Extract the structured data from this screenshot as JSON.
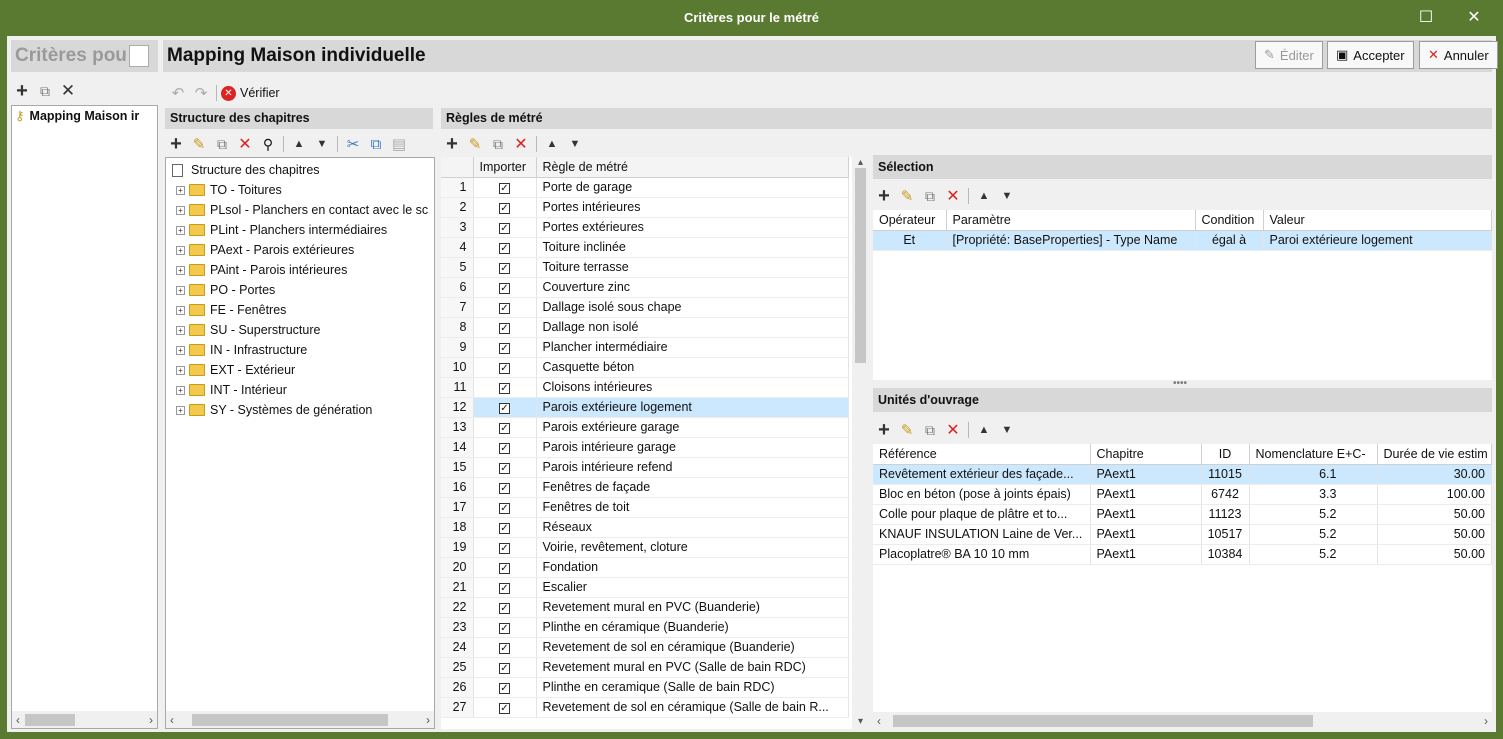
{
  "window": {
    "title": "Critères pour le métré",
    "maximize": "☐",
    "close": "✕"
  },
  "left": {
    "title": "Critères pou",
    "tree_item": "Mapping Maison ir"
  },
  "header": {
    "title": "Mapping Maison individuelle",
    "edit": "Éditer",
    "accept": "Accepter",
    "cancel": "Annuler",
    "verify": "Vérifier"
  },
  "chapters": {
    "header": "Structure des chapitres",
    "root": "Structure des chapitres",
    "items": [
      "TO - Toitures",
      "PLsol - Planchers en contact avec le sc",
      "PLint - Planchers intermédiaires",
      "PAext - Parois extérieures",
      "PAint - Parois intérieures",
      "PO - Portes",
      "FE - Fenêtres",
      "SU - Superstructure",
      "IN - Infrastructure",
      "EXT - Extérieur",
      "INT - Intérieur",
      "SY - Systèmes de génération"
    ]
  },
  "rules": {
    "header": "Règles de métré",
    "col_import": "Importer",
    "col_rule": "Règle de métré",
    "rows": [
      {
        "n": "1",
        "name": "Porte de garage"
      },
      {
        "n": "2",
        "name": "Portes intérieures"
      },
      {
        "n": "3",
        "name": "Portes extérieures"
      },
      {
        "n": "4",
        "name": "Toiture inclinée"
      },
      {
        "n": "5",
        "name": "Toiture terrasse"
      },
      {
        "n": "6",
        "name": "Couverture zinc"
      },
      {
        "n": "7",
        "name": "Dallage isolé sous chape"
      },
      {
        "n": "8",
        "name": "Dallage non isolé"
      },
      {
        "n": "9",
        "name": "Plancher intermédiaire"
      },
      {
        "n": "10",
        "name": "Casquette béton"
      },
      {
        "n": "11",
        "name": "Cloisons intérieures"
      },
      {
        "n": "12",
        "name": "Parois extérieure logement"
      },
      {
        "n": "13",
        "name": "Parois extérieure garage"
      },
      {
        "n": "14",
        "name": "Parois intérieure garage"
      },
      {
        "n": "15",
        "name": "Parois intérieure refend"
      },
      {
        "n": "16",
        "name": "Fenêtres de façade"
      },
      {
        "n": "17",
        "name": "Fenêtres de toit"
      },
      {
        "n": "18",
        "name": "Réseaux"
      },
      {
        "n": "19",
        "name": "Voirie, revêtement, cloture"
      },
      {
        "n": "20",
        "name": "Fondation"
      },
      {
        "n": "21",
        "name": "Escalier"
      },
      {
        "n": "22",
        "name": "Revetement mural en PVC (Buanderie)"
      },
      {
        "n": "23",
        "name": "Plinthe en céramique (Buanderie)"
      },
      {
        "n": "24",
        "name": "Revetement de sol en céramique (Buanderie)"
      },
      {
        "n": "25",
        "name": "Revetement mural en PVC (Salle de bain RDC)"
      },
      {
        "n": "26",
        "name": "Plinthe en ceramique (Salle de bain RDC)"
      },
      {
        "n": "27",
        "name": "Revetement de sol en céramique (Salle de bain R..."
      }
    ]
  },
  "selection": {
    "header": "Sélection",
    "cols": [
      "Opérateur",
      "Paramètre",
      "Condition",
      "Valeur"
    ],
    "row": [
      "Et",
      "[Propriété: BaseProperties] - Type Name",
      "égal à",
      "Paroi extérieure logement"
    ]
  },
  "units": {
    "header": "Unités d'ouvrage",
    "cols": [
      "Référence",
      "Chapitre",
      "ID",
      "Nomenclature E+C-",
      "Durée de vie estim"
    ],
    "rows": [
      [
        "Revêtement extérieur des façade...",
        "PAext1",
        "11015",
        "6.1",
        "30.00"
      ],
      [
        "Bloc en béton (pose à joints épais)",
        "PAext1",
        "6742",
        "3.3",
        "100.00"
      ],
      [
        "Colle pour plaque de plâtre et to...",
        "PAext1",
        "11123",
        "5.2",
        "50.00"
      ],
      [
        "KNAUF INSULATION Laine de Ver...",
        "PAext1",
        "10517",
        "5.2",
        "50.00"
      ],
      [
        "Placoplatre® BA 10 10 mm",
        "PAext1",
        "10384",
        "5.2",
        "50.00"
      ]
    ]
  },
  "colors": {
    "titlebar": "#5a7a31",
    "selected_row": "#cce8ff",
    "header_band": "#d8d8d8"
  }
}
